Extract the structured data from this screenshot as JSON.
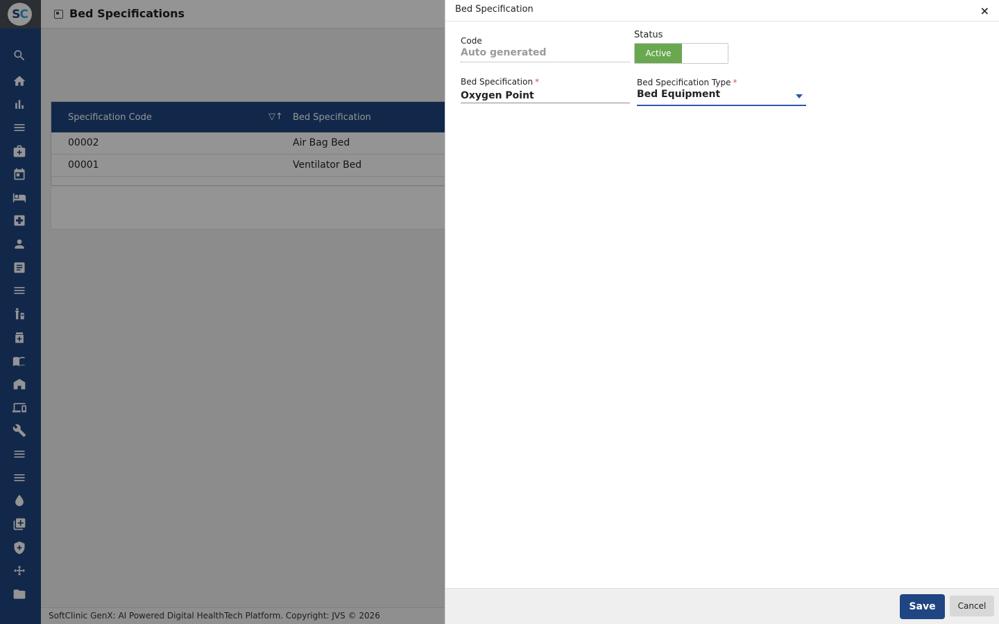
{
  "app": {
    "logo_left": "S",
    "logo_right": "C",
    "page_title": "Bed Specifications",
    "footer_text": "SoftClinic GenX: AI Powered Digital HealthTech Platform. Copyright: JVS © 2026"
  },
  "sidebar": {
    "icons": [
      "search-icon",
      "home-icon",
      "bar-chart-icon",
      "menu-icon",
      "medical-bag-icon",
      "calendar-icon",
      "bed-icon",
      "hospital-plus-icon",
      "person-icon",
      "list-doc-icon",
      "menu-icon",
      "pharmacy-icon",
      "medicine-box-icon",
      "book-icon",
      "building-icon",
      "devices-icon",
      "wrench-icon",
      "menu-icon",
      "menu-icon",
      "drop-icon",
      "add-box-icon",
      "shield-icon",
      "network-icon",
      "folder-icon"
    ]
  },
  "grid": {
    "columns": [
      "Specification Code",
      "Bed Specification"
    ],
    "rows": [
      {
        "code": "00002",
        "spec": "Air Bag Bed"
      },
      {
        "code": "00001",
        "spec": "Ventilator Bed"
      }
    ]
  },
  "drawer": {
    "title": "Bed Specification",
    "close_glyph": "×",
    "code_label": "Code",
    "code_value": "Auto generated",
    "status_label": "Status",
    "status_value": "Active",
    "spec_label": "Bed Specification",
    "spec_value": "Oxygen Point",
    "type_label": "Bed Specification Type",
    "type_value": "Bed Equipment",
    "required_mark": "*",
    "save_label": "Save",
    "cancel_label": "Cancel"
  },
  "colors": {
    "brand": "#1f4582",
    "active": "#6aa84f",
    "focus": "#2a56a8",
    "required": "#d9534f"
  }
}
